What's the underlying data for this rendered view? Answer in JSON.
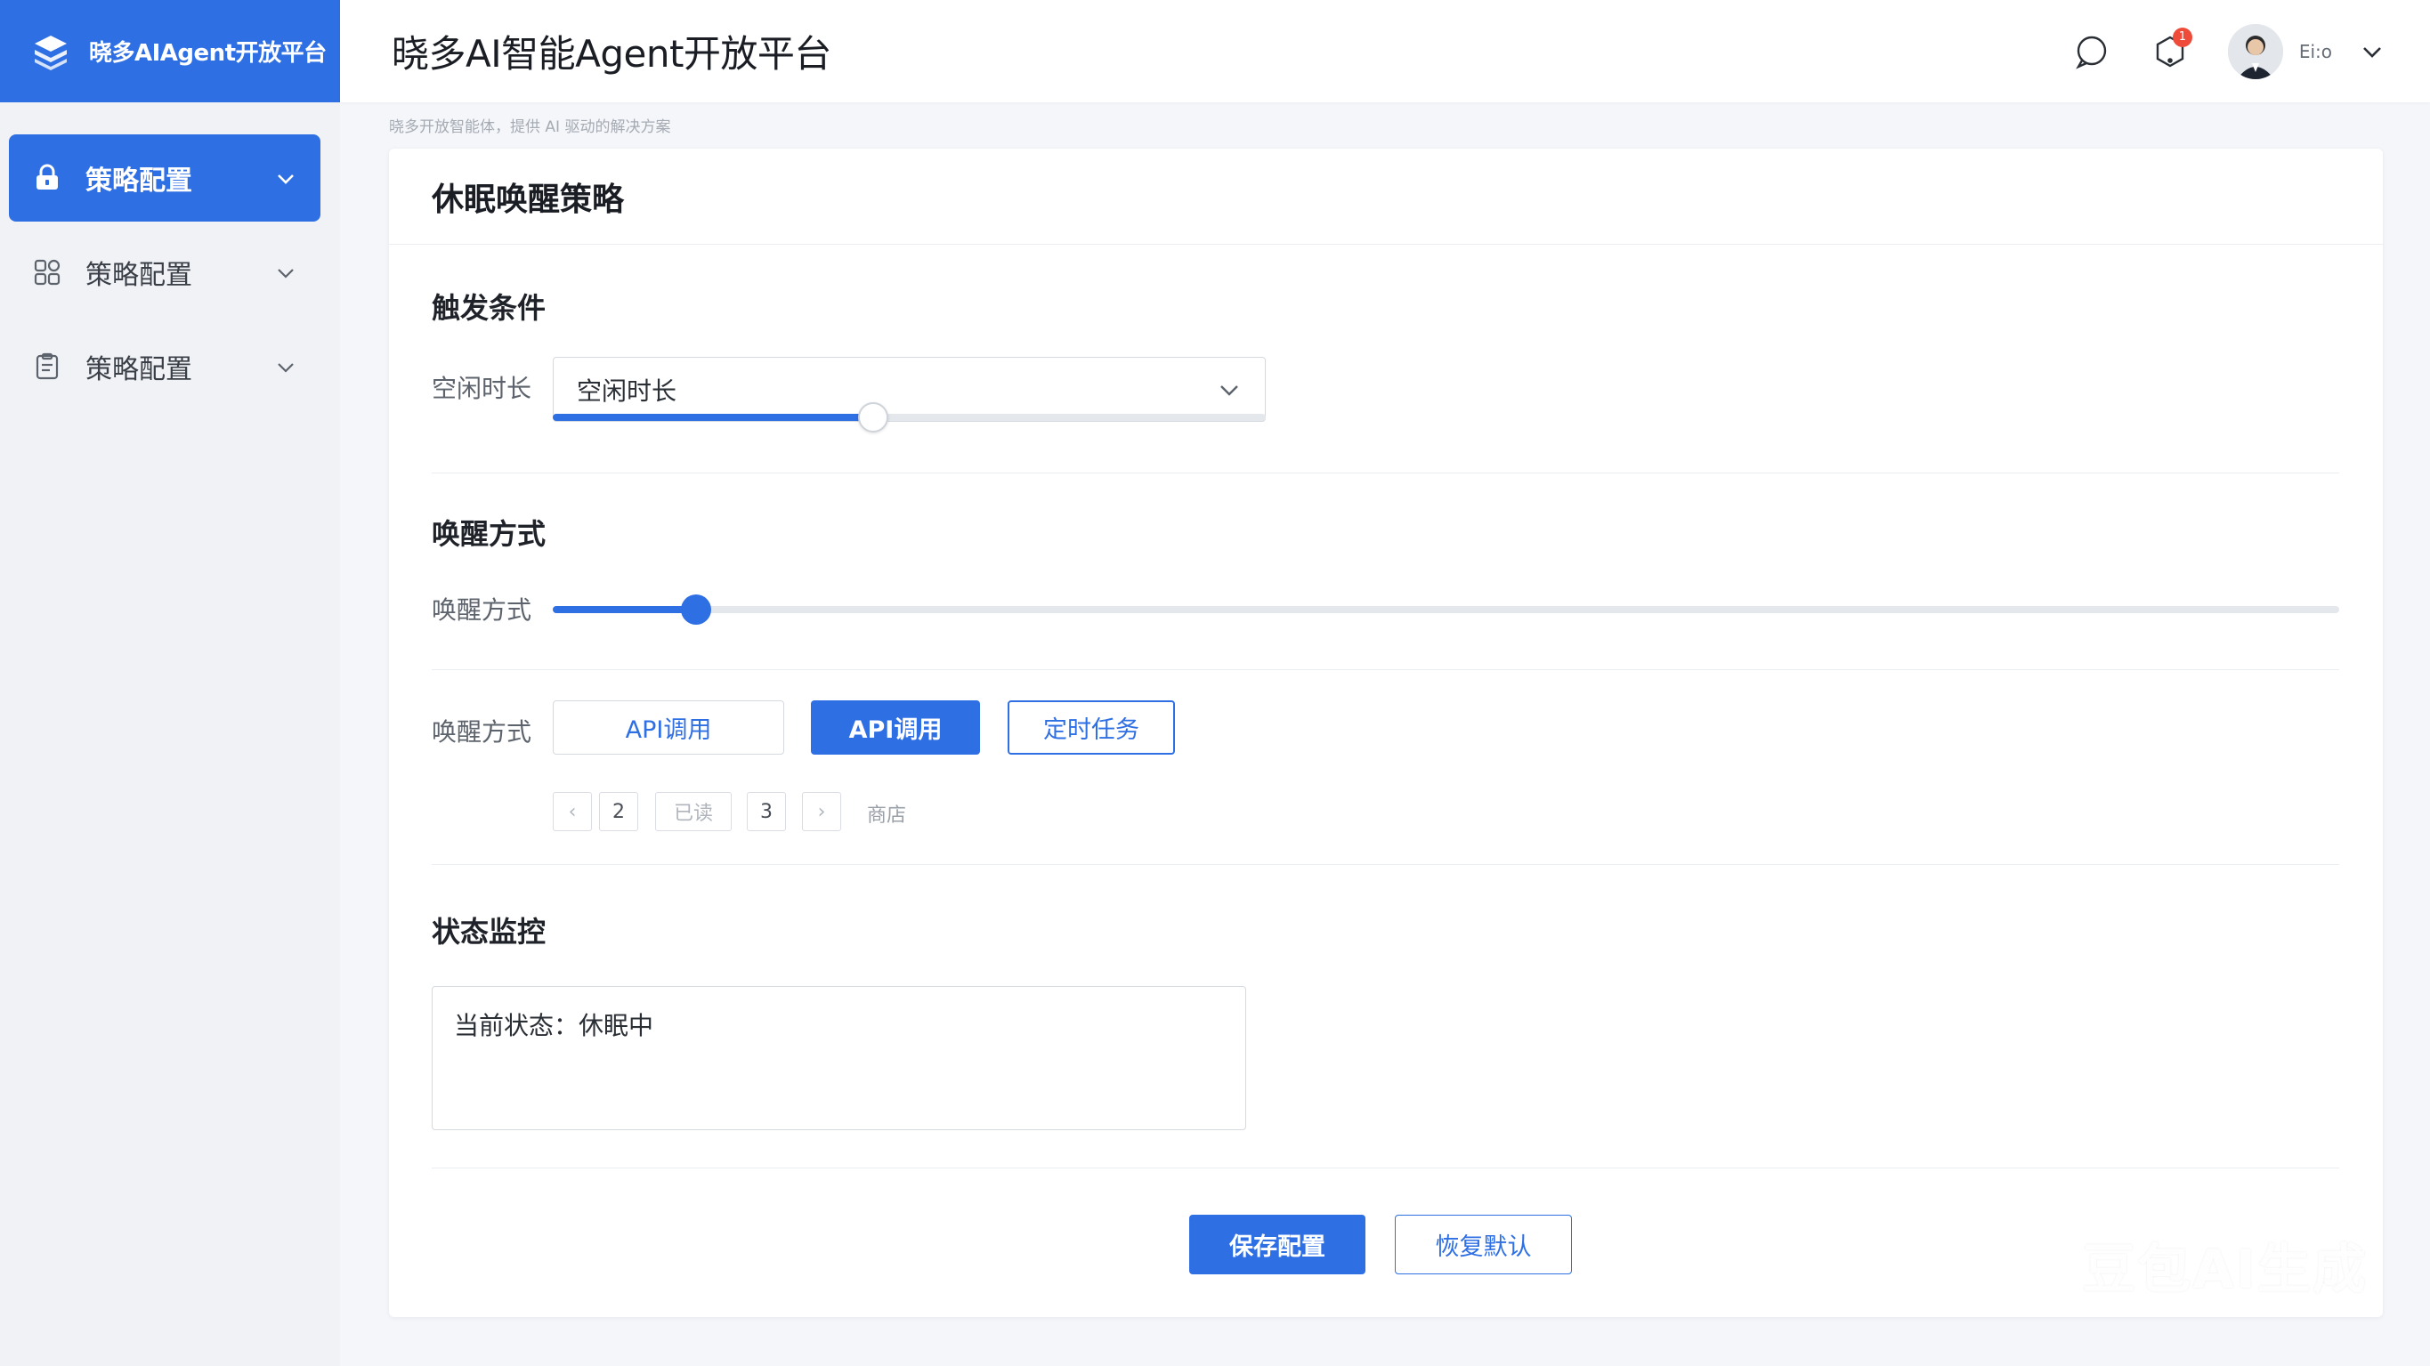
{
  "brand": {
    "name": "晓多AIAgent开放平台",
    "color": "#2f6fe4"
  },
  "header": {
    "title": "晓多AI智能Agent开放平台",
    "notification_count": "1",
    "username": "Ei:o"
  },
  "sidebar": {
    "items": [
      {
        "label": "策略配置",
        "active": true,
        "icon": "lock-icon"
      },
      {
        "label": "策略配置",
        "active": false,
        "icon": "grid-icon"
      },
      {
        "label": "策略配置",
        "active": false,
        "icon": "clipboard-icon"
      }
    ]
  },
  "hint_text": "晓多开放智能体，提供 AI 驱动的解决方案",
  "card": {
    "title": "休眠唤醒策略",
    "trigger": {
      "section_title": "触发条件",
      "idle_label": "空闲时长",
      "select_value": "空闲时长",
      "slider_value": 0.45
    },
    "wake": {
      "section_title": "唤醒方式",
      "slider_label": "唤醒方式",
      "slider_value": 0.08,
      "buttons_label": "唤醒方式",
      "btn_api_1": "API调用",
      "btn_api_2": "API调用",
      "btn_timer": "定时任务",
      "pager": {
        "prev": "‹",
        "p2": "2",
        "mid": "已读",
        "p3": "3",
        "next": "›",
        "after": "商店"
      }
    },
    "monitor": {
      "section_title": "状态监控",
      "status_text": "当前状态：休眠中"
    },
    "actions": {
      "save": "保存配置",
      "reset": "恢复默认"
    }
  },
  "watermark": "豆包AI生成"
}
